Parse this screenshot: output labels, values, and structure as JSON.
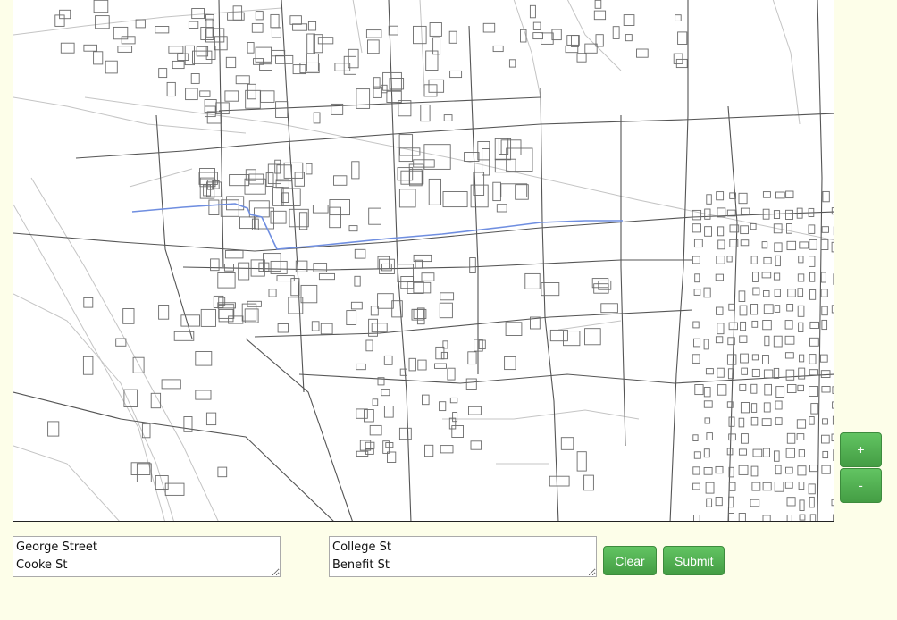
{
  "map": {
    "route_color": "#6f8ee0",
    "major_road_color": "#555555",
    "minor_road_color": "#bbbbbb",
    "building_color": "#666666"
  },
  "zoom": {
    "in_label": "+",
    "out_label": "-"
  },
  "form": {
    "from_value": "George Street\nCooke St",
    "to_value": "College St\nBenefit St",
    "clear_label": "Clear",
    "submit_label": "Submit"
  },
  "colors": {
    "background": "#fdfee9",
    "button_green": "#5cb85c"
  }
}
